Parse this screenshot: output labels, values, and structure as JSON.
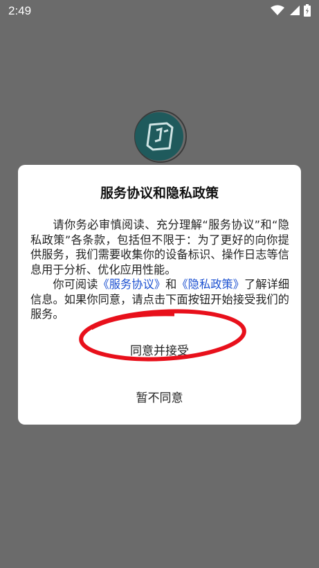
{
  "status_bar": {
    "time": "2:49"
  },
  "dialog": {
    "title": "服务协议和隐私政策",
    "p1": "请你务必审慎阅读、充分理解“服务协议”和“隐私政策”各条款，包括但不限于：为了更好的向你提供服务，我们需要收集你的设备标识、操作日志等信息用于分析、优化应用性能。",
    "p2_prefix": "你可阅读",
    "link_service": "《服务协议》",
    "p2_and": "和",
    "link_privacy": "《隐私政策》",
    "p2_suffix": "了解详细信息。如果你同意，请点击下面按钮开始接受我们的服务。",
    "agree_label": "同意并接受",
    "disagree_label": "暂不同意"
  },
  "colors": {
    "overlay": "#6b6b6b",
    "link": "#1a4fd0",
    "annotation": "#e8101b",
    "logo": "#1f5a5c"
  },
  "icons": [
    "wifi-icon",
    "signal-icon",
    "battery-icon",
    "app-logo-icon"
  ]
}
